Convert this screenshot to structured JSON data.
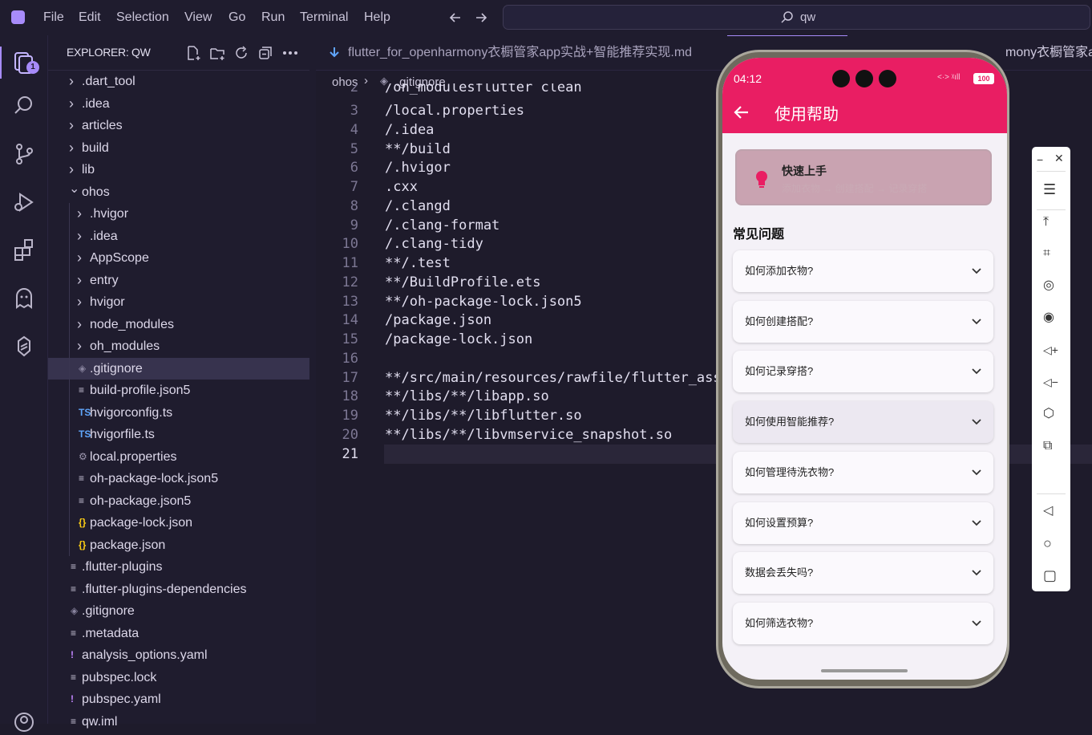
{
  "menu": [
    "File",
    "Edit",
    "Selection",
    "View",
    "Go",
    "Run",
    "Terminal",
    "Help"
  ],
  "search": {
    "text": "qw"
  },
  "activity": {
    "badge": "1"
  },
  "explorer": {
    "title": "EXPLORER: QW",
    "items": [
      {
        "name": ".dart_tool",
        "kind": "folder",
        "depth": 0,
        "open": false
      },
      {
        "name": ".idea",
        "kind": "folder",
        "depth": 0,
        "open": false
      },
      {
        "name": "articles",
        "kind": "folder",
        "depth": 0,
        "open": false
      },
      {
        "name": "build",
        "kind": "folder",
        "depth": 0,
        "open": false
      },
      {
        "name": "lib",
        "kind": "folder",
        "depth": 0,
        "open": false
      },
      {
        "name": "ohos",
        "kind": "folder",
        "depth": 0,
        "open": true
      },
      {
        "name": ".hvigor",
        "kind": "folder",
        "depth": 1,
        "open": false
      },
      {
        "name": ".idea",
        "kind": "folder",
        "depth": 1,
        "open": false
      },
      {
        "name": "AppScope",
        "kind": "folder",
        "depth": 1,
        "open": false
      },
      {
        "name": "entry",
        "kind": "folder",
        "depth": 1,
        "open": false
      },
      {
        "name": "hvigor",
        "kind": "folder",
        "depth": 1,
        "open": false
      },
      {
        "name": "node_modules",
        "kind": "folder",
        "depth": 1,
        "open": false
      },
      {
        "name": "oh_modules",
        "kind": "folder",
        "depth": 1,
        "open": false
      },
      {
        "name": ".gitignore",
        "kind": "git",
        "depth": 1,
        "selected": true
      },
      {
        "name": "build-profile.json5",
        "kind": "lines",
        "depth": 1
      },
      {
        "name": "hvigorconfig.ts",
        "kind": "ts",
        "depth": 1
      },
      {
        "name": "hvigorfile.ts",
        "kind": "ts",
        "depth": 1
      },
      {
        "name": "local.properties",
        "kind": "gear",
        "depth": 1
      },
      {
        "name": "oh-package-lock.json5",
        "kind": "lines",
        "depth": 1
      },
      {
        "name": "oh-package.json5",
        "kind": "lines",
        "depth": 1
      },
      {
        "name": "package-lock.json",
        "kind": "json",
        "depth": 1
      },
      {
        "name": "package.json",
        "kind": "json",
        "depth": 1
      },
      {
        "name": ".flutter-plugins",
        "kind": "lines",
        "depth": 0
      },
      {
        "name": ".flutter-plugins-dependencies",
        "kind": "lines",
        "depth": 0
      },
      {
        "name": ".gitignore",
        "kind": "git",
        "depth": 0
      },
      {
        "name": ".metadata",
        "kind": "lines",
        "depth": 0
      },
      {
        "name": "analysis_options.yaml",
        "kind": "yaml",
        "depth": 0
      },
      {
        "name": "pubspec.lock",
        "kind": "lines",
        "depth": 0
      },
      {
        "name": "pubspec.yaml",
        "kind": "yaml",
        "depth": 0
      },
      {
        "name": "qw.iml",
        "kind": "lines",
        "depth": 0
      }
    ]
  },
  "tabs": {
    "active": "flutter_for_openharmony衣橱管家app实战+智能推荐实现.md",
    "active_tail": "mony衣橱管家app"
  },
  "breadcrumb": {
    "folder": "ohos",
    "file": ".gitignore"
  },
  "code": {
    "partial_top": "/oh_modulesflutter clean",
    "lines": [
      {
        "n": "3",
        "t": "/local.properties"
      },
      {
        "n": "4",
        "t": "/.idea"
      },
      {
        "n": "5",
        "t": "**/build"
      },
      {
        "n": "6",
        "t": "/.hvigor"
      },
      {
        "n": "7",
        "t": ".cxx"
      },
      {
        "n": "8",
        "t": "/.clangd"
      },
      {
        "n": "9",
        "t": "/.clang-format"
      },
      {
        "n": "10",
        "t": "/.clang-tidy"
      },
      {
        "n": "11",
        "t": "**/.test"
      },
      {
        "n": "12",
        "t": "**/BuildProfile.ets"
      },
      {
        "n": "13",
        "t": "**/oh-package-lock.json5"
      },
      {
        "n": "14",
        "t": "/package.json"
      },
      {
        "n": "15",
        "t": "/package-lock.json"
      },
      {
        "n": "16",
        "t": ""
      },
      {
        "n": "17",
        "t": "**/src/main/resources/rawfile/flutter_asset"
      },
      {
        "n": "18",
        "t": "**/libs/**/libapp.so"
      },
      {
        "n": "19",
        "t": "**/libs/**/libflutter.so"
      },
      {
        "n": "20",
        "t": "**/libs/**/libvmservice_snapshot.so"
      },
      {
        "n": "21",
        "t": ""
      }
    ]
  },
  "phone": {
    "time": "04:12",
    "battery": "100",
    "title": "使用帮助",
    "quick": {
      "title": "快速上手",
      "subtitle": "添加衣物 → 创建搭配 → 记录穿搭"
    },
    "section": "常见问题",
    "faqs": [
      "如何添加衣物?",
      "如何创建搭配?",
      "如何记录穿搭?",
      "如何使用智能推荐?",
      "如何管理待洗衣物?",
      "如何设置预算?",
      "数据会丢失吗?",
      "如何筛选衣物?"
    ],
    "accent": "#e91e63"
  },
  "colors": {
    "bg": "#1e1b2b",
    "sidebar": "#1f1c2e",
    "selection": "#37334e",
    "accent": "#e91e63"
  }
}
